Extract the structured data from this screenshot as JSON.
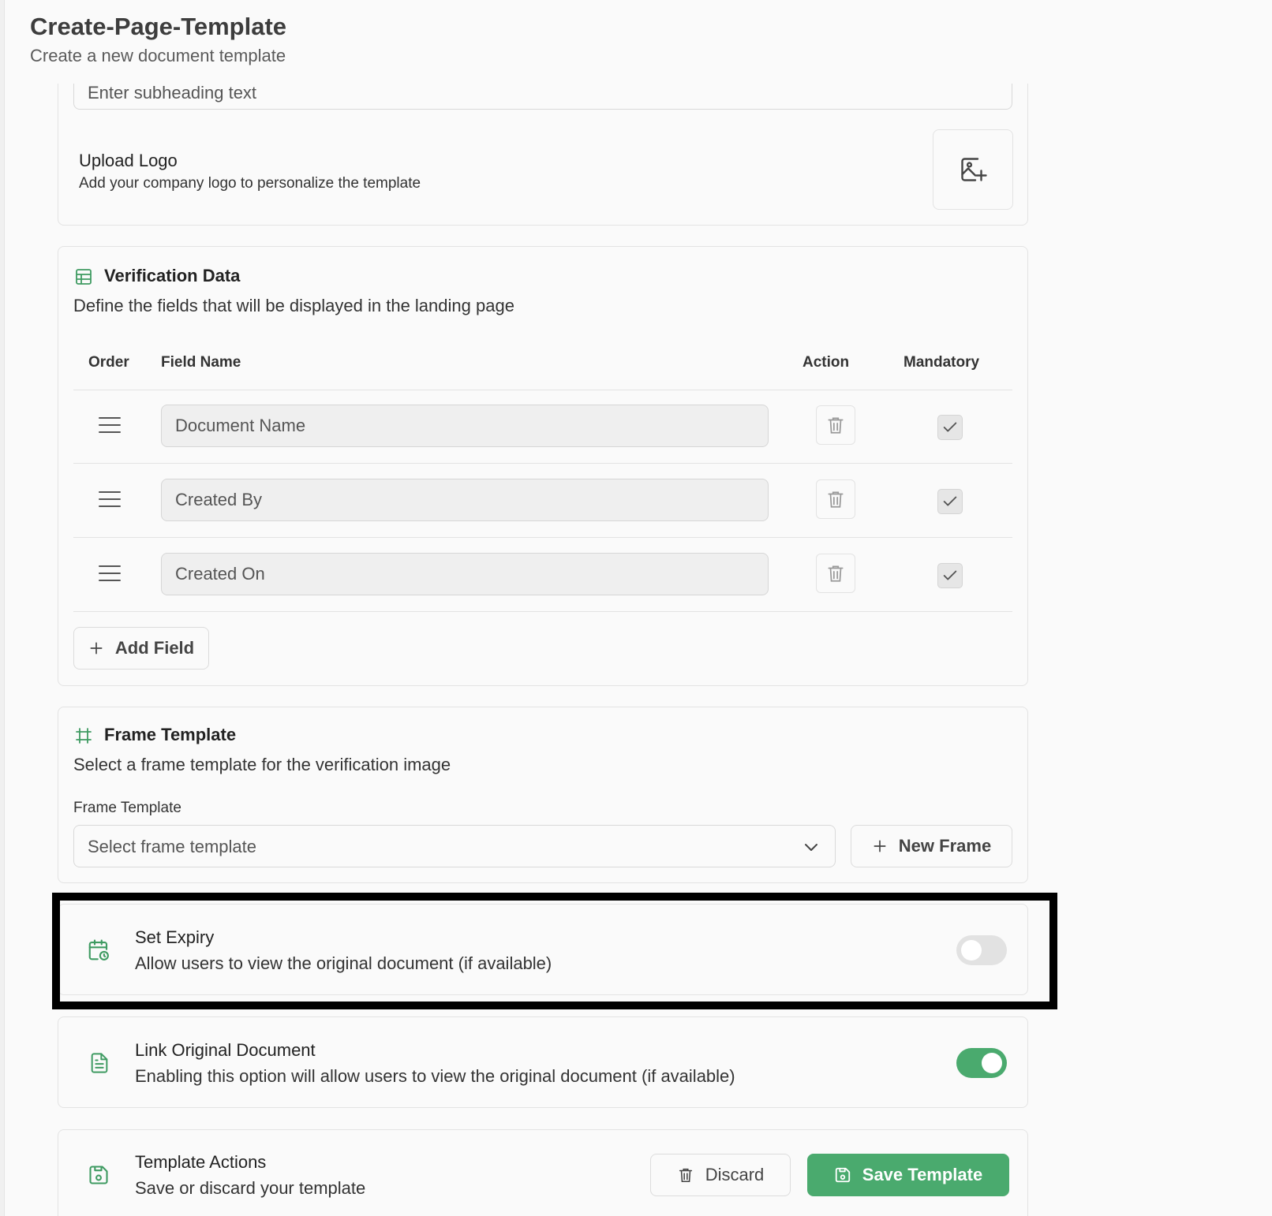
{
  "header": {
    "title": "Create-Page-Template",
    "subtitle": "Create a new document template"
  },
  "branding": {
    "subheading_placeholder": "Enter subheading text",
    "upload_logo_title": "Upload Logo",
    "upload_logo_desc": "Add your company logo to personalize the template"
  },
  "verification": {
    "title": "Verification Data",
    "description": "Define the fields that will be displayed in the landing page",
    "columns": {
      "order": "Order",
      "field_name": "Field Name",
      "action": "Action",
      "mandatory": "Mandatory"
    },
    "rows": [
      {
        "field_name": "Document Name",
        "mandatory": true
      },
      {
        "field_name": "Created By",
        "mandatory": true
      },
      {
        "field_name": "Created On",
        "mandatory": true
      }
    ],
    "add_field_label": "Add Field"
  },
  "frame": {
    "title": "Frame Template",
    "description": "Select a frame template for the verification image",
    "field_label": "Frame Template",
    "select_placeholder": "Select frame template",
    "new_frame_label": "New Frame"
  },
  "expiry": {
    "title": "Set Expiry",
    "description": "Allow users to view the original document (if available)",
    "enabled": false
  },
  "link_original": {
    "title": "Link Original Document",
    "description": "Enabling this option will allow users to view the original document (if available)",
    "enabled": true
  },
  "actions": {
    "title": "Template Actions",
    "description": "Save or discard your template",
    "discard_label": "Discard",
    "save_label": "Save Template"
  },
  "colors": {
    "accent": "#4aaa6e",
    "toggle_off": "#e2e2e2",
    "icon_green": "#3f9b62"
  }
}
